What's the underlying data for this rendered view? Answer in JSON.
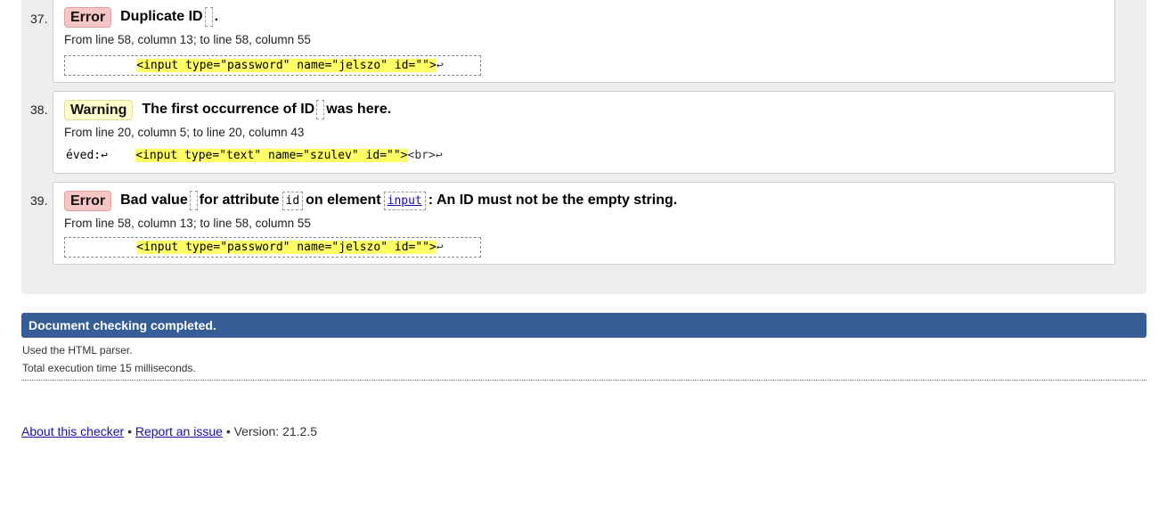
{
  "messages": [
    {
      "number": "37.",
      "badge": "Error",
      "title_pre": "Duplicate ID",
      "title_post": ".",
      "location": "From line 58, column 13; to line 58, column 55",
      "extract_pre": "          ",
      "extract_hl": "<input type=\"password\" name=\"jelszo\" id=\"\">",
      "extract_post": "↩"
    },
    {
      "number": "38.",
      "badge": "Warning",
      "title_pre": "The first occurrence of ID",
      "title_post": "was here.",
      "location": "From line 20, column 5; to line 20, column 43",
      "extract_pre": "éved:↩    ",
      "extract_hl": "<input type=\"text\" name=\"szulev\" id=\"\">",
      "extract_post": "<br>↩"
    },
    {
      "number": "39.",
      "badge": "Error",
      "title_pre": "Bad value",
      "title_mid1": "for attribute",
      "attr_name": "id",
      "title_mid2": "on element",
      "element_link": "input",
      "title_post": ": An ID must not be the empty string.",
      "location": "From line 58, column 13; to line 58, column 55",
      "extract_pre": "          ",
      "extract_hl": "<input type=\"password\" name=\"jelszo\" id=\"\">",
      "extract_post": "↩"
    }
  ],
  "status": {
    "completed": "Document checking completed.",
    "parser": "Used the HTML parser.",
    "execution_time": "Total execution time 15 milliseconds."
  },
  "footer": {
    "about_link": "About this checker",
    "separator": "•",
    "report_link": "Report an issue",
    "version": "Version: 21.2.5"
  },
  "colors": {
    "error_badge": "#f6c6c6",
    "warning_badge": "#ffffcc",
    "highlight": "#ffff66",
    "status_bar": "#365d95",
    "results_bg": "#eeeeee"
  }
}
